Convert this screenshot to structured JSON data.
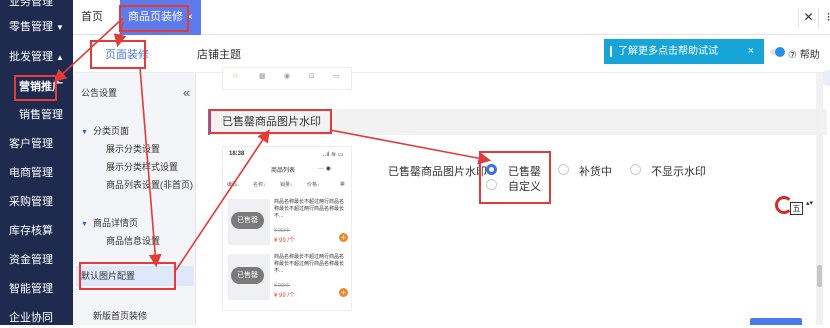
{
  "sidebar": {
    "items": [
      {
        "label": "业务管理",
        "caret": ""
      },
      {
        "label": "零售管理",
        "caret": "▼"
      },
      {
        "label": "批发管理",
        "caret": "▲"
      },
      {
        "label": "营销推广",
        "caret": ""
      },
      {
        "label": "销售管理",
        "caret": ""
      },
      {
        "label": "客户管理",
        "caret": ""
      },
      {
        "label": "电商管理",
        "caret": ""
      },
      {
        "label": "采购管理",
        "caret": ""
      },
      {
        "label": "库存核算",
        "caret": ""
      },
      {
        "label": "资金管理",
        "caret": ""
      },
      {
        "label": "智能管理",
        "caret": ""
      },
      {
        "label": "企业协同",
        "caret": ""
      }
    ]
  },
  "tabs": {
    "home": "首页",
    "active": "商品页装修",
    "close": "×",
    "window_close": "✕",
    "window_more": "⁝"
  },
  "subtabs": {
    "page_decoration": "页面装修",
    "store_theme": "店铺主题"
  },
  "help": {
    "banner_text": "了解更多点击帮助试试",
    "banner_close": "×",
    "help_label": "⑦ 帮助"
  },
  "settings_list": {
    "collapse_icon": "«",
    "announcement": "公告设置",
    "category_group": "分类页面",
    "category_items": [
      "展示分类设置",
      "展示分类样式设置",
      "商品列表设置(非首页)"
    ],
    "detail_group": "商品详情页",
    "detail_items": [
      "商品信息设置"
    ],
    "default_image": "默认图片配置",
    "new_home": "新版首页装修"
  },
  "preview": {
    "strip_icons": [
      "⌂",
      "▦",
      "◉",
      "⊡",
      "▭"
    ],
    "time": "18:38",
    "signal": "..ıl ≋ ▭",
    "title": "商品列表",
    "more": "··· ◉",
    "filters": [
      "编码↓",
      "名称↓",
      "销量↓",
      "价格↓",
      "▦"
    ],
    "products": [
      {
        "badge": "已售罄",
        "name": "商品名称最长不超过两行商品名称最长不超过两行商品名称最长不...",
        "orig": "¥ 99/个",
        "price": "¥ 99 /个",
        "add": "+"
      },
      {
        "badge": "已售罄",
        "name": "商品名称最长不超过两行商品名称最长不超过两行商品名称最长不...",
        "orig": "¥ 99/个",
        "price": "¥ 99 /个",
        "add": "+"
      }
    ]
  },
  "section": {
    "header": "已售罄商品图片水印"
  },
  "watermark": {
    "label": "已售罄商品图片水印",
    "options": [
      {
        "label": "已售罄",
        "checked": true
      },
      {
        "label": "补货中",
        "checked": false
      },
      {
        "label": "不显示水印",
        "checked": false
      },
      {
        "label": "自定义",
        "checked": false
      }
    ]
  },
  "misc": {
    "ime_label": "五",
    "ime_arrows": "▴▾"
  },
  "colors": {
    "sidebar_bg": "#1e2b4f",
    "accent": "#4b7bea",
    "annotation": "#e23b3b",
    "help_banner": "#16a5d6"
  }
}
